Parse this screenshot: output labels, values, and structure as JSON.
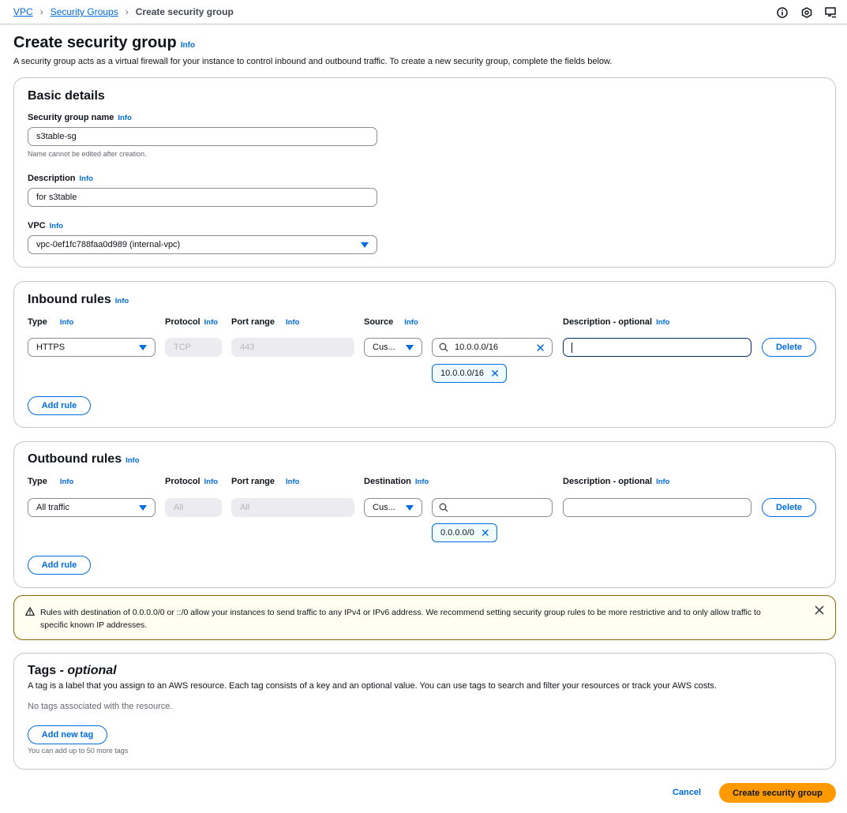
{
  "breadcrumb": {
    "items": [
      "VPC",
      "Security Groups"
    ],
    "current": "Create security group"
  },
  "top_icons": [
    "info-circle-icon",
    "settings-hex-icon",
    "cloudshell-icon"
  ],
  "header": {
    "title": "Create security group",
    "info": "Info",
    "description": "A security group acts as a virtual firewall for your instance to control inbound and outbound traffic. To create a new security group, complete the fields below."
  },
  "basic": {
    "title": "Basic details",
    "name_label": "Security group name",
    "name_value": "s3table-sg",
    "name_hint": "Name cannot be edited after creation.",
    "desc_label": "Description",
    "desc_value": "for s3table",
    "vpc_label": "VPC",
    "vpc_value": "vpc-0ef1fc788faa0d989 (internal-vpc)",
    "info": "Info"
  },
  "inbound": {
    "title": "Inbound rules",
    "info": "Info",
    "columns": {
      "type": "Type",
      "protocol": "Protocol",
      "port": "Port range",
      "source": "Source",
      "description": "Description - optional"
    },
    "rule": {
      "type": "HTTPS",
      "protocol": "TCP",
      "port": "443",
      "source_type": "Cus...",
      "search_value": "10.0.0.0/16",
      "token": "10.0.0.0/16",
      "description": ""
    },
    "delete_label": "Delete",
    "add_rule_label": "Add rule"
  },
  "outbound": {
    "title": "Outbound rules",
    "info": "Info",
    "columns": {
      "type": "Type",
      "protocol": "Protocol",
      "port": "Port range",
      "destination": "Destination",
      "description": "Description - optional"
    },
    "rule": {
      "type": "All traffic",
      "protocol": "All",
      "port": "All",
      "dest_type": "Cus...",
      "search_value": "",
      "token": "0.0.0.0/0",
      "description": ""
    },
    "delete_label": "Delete",
    "add_rule_label": "Add rule"
  },
  "alert": {
    "text": "Rules with destination of 0.0.0.0/0 or ::/0 allow your instances to send traffic to any IPv4 or IPv6 address. We recommend setting security group rules to be more restrictive and to only allow traffic to specific known IP addresses."
  },
  "tags": {
    "title": "Tags - ",
    "title_em": "optional",
    "description": "A tag is a label that you assign to an AWS resource. Each tag consists of a key and an optional value. You can use tags to search and filter your resources or track your AWS costs.",
    "empty": "No tags associated with the resource.",
    "add_label": "Add new tag",
    "limit_hint": "You can add up to 50 more tags"
  },
  "footer": {
    "cancel_label": "Cancel",
    "create_label": "Create security group"
  },
  "colors": {
    "accent": "#006ce0",
    "primary_button": "#ff9900",
    "warning_border": "#8d6605"
  }
}
